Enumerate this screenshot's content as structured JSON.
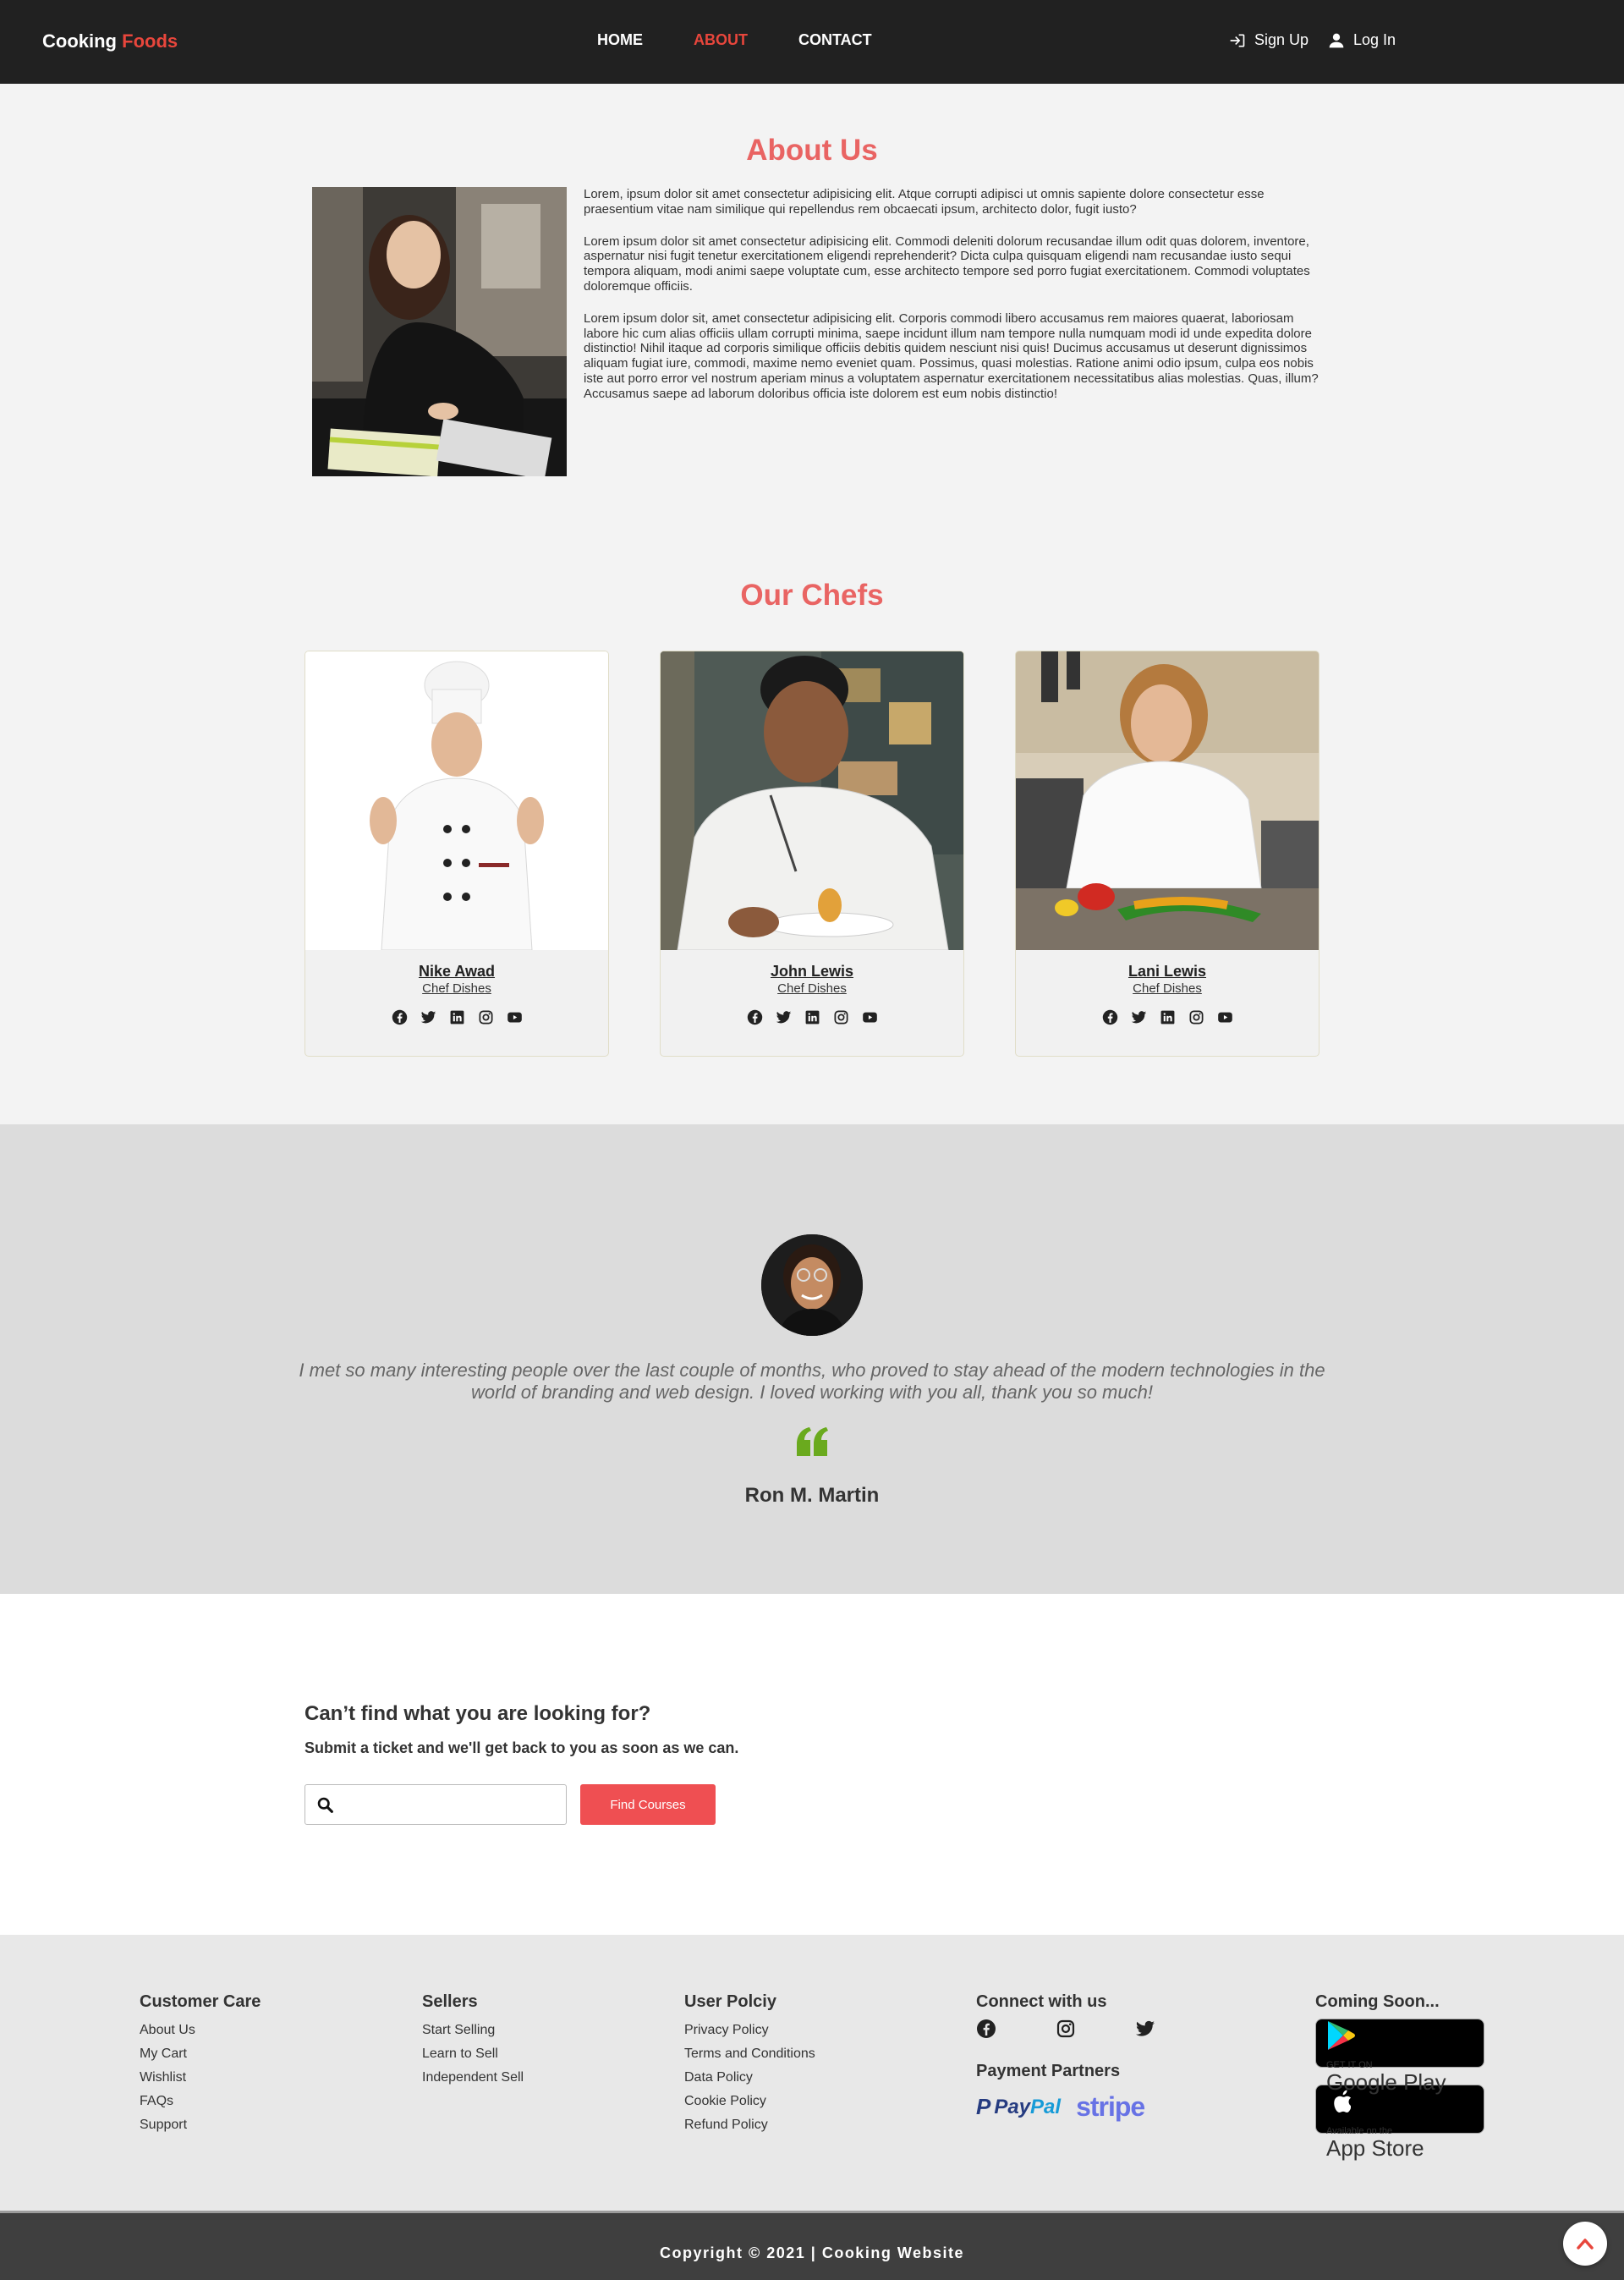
{
  "nav": {
    "brand_main": "Cooking",
    "brand_accent": "Foods",
    "links": [
      "HOME",
      "ABOUT",
      "CONTACT"
    ],
    "active_link": "ABOUT",
    "signup_label": "Sign Up",
    "login_label": "Log In"
  },
  "about": {
    "title": "About Us",
    "paragraphs": [
      "Lorem, ipsum dolor sit amet consectetur adipisicing elit. Atque corrupti adipisci ut omnis sapiente dolore consectetur esse praesentium vitae nam similique qui repellendus rem obcaecati ipsum, architecto dolor, fugit iusto?",
      "Lorem ipsum dolor sit amet consectetur adipisicing elit. Commodi deleniti dolorum recusandae illum odit quas dolorem, inventore, aspernatur nisi fugit tenetur exercitationem eligendi reprehenderit? Dicta culpa quisquam eligendi nam recusandae iusto sequi tempora aliquam, modi animi saepe voluptate cum, esse architecto tempore sed porro fugiat exercitationem. Commodi voluptates doloremque officiis.",
      "Lorem ipsum dolor sit, amet consectetur adipisicing elit. Corporis commodi libero accusamus rem maiores quaerat, laboriosam labore hic cum alias officiis ullam corrupti minima, saepe incidunt illum nam tempore nulla numquam modi id unde expedita dolore distinctio! Nihil itaque ad corporis similique officiis debitis quidem nesciunt nisi quis! Ducimus accusamus ut deserunt dignissimos aliquam fugiat iure, commodi, maxime nemo eveniet quam. Possimus, quasi molestias. Ratione animi odio ipsum, culpa eos nobis iste aut porro error vel nostrum aperiam minus a voluptatem aspernatur exercitationem necessitatibus alias molestias. Quas, illum? Accusamus saepe ad laborum doloribus officia iste dolorem est eum nobis distinctio!"
    ]
  },
  "chefs": {
    "title": "Our Chefs",
    "cards": [
      {
        "name": "Nike Awad",
        "role": "Chef Dishes"
      },
      {
        "name": "John Lewis",
        "role": "Chef Dishes"
      },
      {
        "name": "Lani Lewis",
        "role": "Chef Dishes"
      }
    ],
    "social_icons": [
      "facebook-icon",
      "twitter-icon",
      "linkedin-icon",
      "instagram-icon",
      "youtube-icon"
    ]
  },
  "testimonial": {
    "quote": "I met so many interesting people over the last couple of months, who proved to stay ahead of the modern technologies in the world of branding and web design. I loved working with you all, thank you so much!",
    "author": "Ron M. Martin",
    "quote_icon_color": "#6aaa1e"
  },
  "search": {
    "heading": "Can’t find what you are looking for?",
    "subheading": "Submit a ticket and we'll get back to you as soon as we can.",
    "input_value": "",
    "button_label": "Find Courses"
  },
  "footer": {
    "customer_care": {
      "title": "Customer Care",
      "links": [
        "About Us",
        "My Cart",
        "Wishlist",
        "FAQs",
        "Support"
      ]
    },
    "sellers": {
      "title": "Sellers",
      "links": [
        "Start Selling",
        "Learn to Sell",
        "Independent Sell"
      ]
    },
    "user_policy": {
      "title": "User Polciy",
      "links": [
        "Privacy Policy",
        "Terms and Conditions",
        "Data Policy",
        "Cookie Policy",
        "Refund Policy"
      ]
    },
    "connect": {
      "title": "Connect with us",
      "icons": [
        "facebook-icon",
        "instagram-icon",
        "twitter-icon"
      ]
    },
    "payment": {
      "title": "Payment Partners",
      "paypal_a": "Pay",
      "paypal_b": "Pal",
      "stripe": "stripe"
    },
    "coming_soon": {
      "title": "Coming Soon...",
      "google_small": "GET IT ON",
      "google_big": "Google Play",
      "apple_small": "Available on the",
      "apple_big": "App Store"
    }
  },
  "copyright": "Copyright © 2021 | Cooking Website",
  "colors": {
    "accent": "#e8463c",
    "heading": "#e96463",
    "button": "#ef4f52",
    "navbar": "#212121"
  }
}
